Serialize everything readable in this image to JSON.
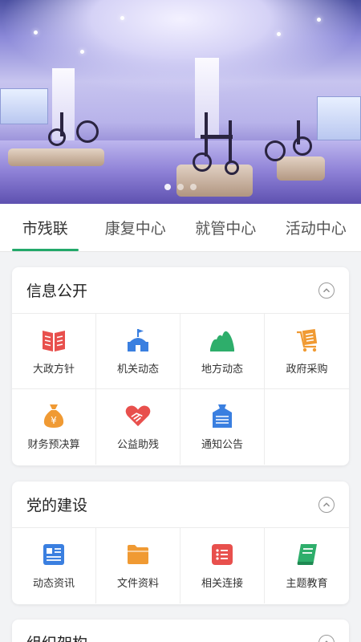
{
  "banner": {
    "slide_count": 3,
    "active_slide": 1
  },
  "tabs": [
    {
      "label": "市残联",
      "active": true
    },
    {
      "label": "康复中心",
      "active": false
    },
    {
      "label": "就管中心",
      "active": false
    },
    {
      "label": "活动中心",
      "active": false
    }
  ],
  "sections": [
    {
      "title": "信息公开",
      "items": [
        {
          "label": "大政方针",
          "icon": "book-icon",
          "color": "#e8504d"
        },
        {
          "label": "机关动态",
          "icon": "building-flag-icon",
          "color": "#3a7fe0"
        },
        {
          "label": "地方动态",
          "icon": "mountain-icon",
          "color": "#2eae6b"
        },
        {
          "label": "政府采购",
          "icon": "cart-document-icon",
          "color": "#f09a33"
        },
        {
          "label": "财务预决算",
          "icon": "money-bag-icon",
          "color": "#f09a33"
        },
        {
          "label": "公益助残",
          "icon": "heart-hand-icon",
          "color": "#e8504d"
        },
        {
          "label": "通知公告",
          "icon": "notice-icon",
          "color": "#3a7fe0"
        }
      ]
    },
    {
      "title": "党的建设",
      "items": [
        {
          "label": "动态资讯",
          "icon": "news-icon",
          "color": "#3a7fe0"
        },
        {
          "label": "文件资料",
          "icon": "folder-icon",
          "color": "#f09a33"
        },
        {
          "label": "相关连接",
          "icon": "list-icon",
          "color": "#e8504d"
        },
        {
          "label": "主题教育",
          "icon": "study-book-icon",
          "color": "#2eae6b"
        }
      ]
    },
    {
      "title": "组织架构"
    }
  ]
}
